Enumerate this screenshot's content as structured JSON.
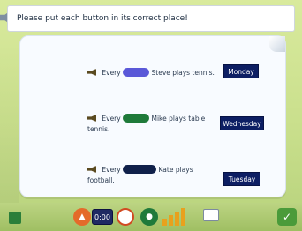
{
  "instruction": {
    "text": "Please put each button in its correct place!"
  },
  "sentences": [
    {
      "prefix": "Every",
      "suffix": "Steve plays tennis.",
      "day": "Monday"
    },
    {
      "prefix": "Every",
      "suffix_line1": "Mike plays table",
      "suffix_line2": "tennis.",
      "day": "Wednesday"
    },
    {
      "prefix": "Every",
      "suffix_line1": "Kate plays",
      "suffix_line2": "football.",
      "day": "Tuesday"
    }
  ],
  "toolbar": {
    "time_label": "0:00",
    "check_label": "✓"
  },
  "icons": {
    "speaker": "speaker-icon",
    "check": "check-icon",
    "flask": "flask-icon",
    "cone": "cone-icon",
    "arc": "arc-icon",
    "window": "window-icon",
    "bars": "bars-icon"
  }
}
